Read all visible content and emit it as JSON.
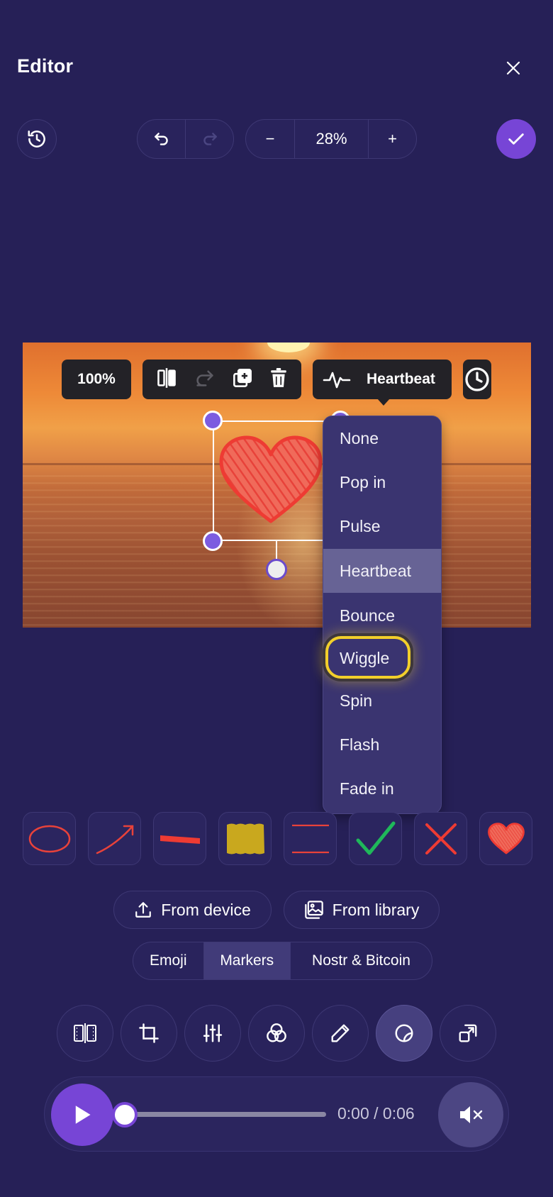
{
  "header": {
    "title": "Editor"
  },
  "toolbar": {
    "zoom_minus": "−",
    "zoom_value": "28%",
    "zoom_plus": "+"
  },
  "canvas_bar": {
    "opacity": "100%",
    "animation_label": "Heartbeat"
  },
  "animation_menu": {
    "items": [
      "None",
      "Pop in",
      "Pulse",
      "Heartbeat",
      "Bounce",
      "Wiggle",
      "Spin",
      "Flash",
      "Fade in"
    ],
    "selected": "Heartbeat",
    "highlighted": "Wiggle"
  },
  "sources": {
    "device_label": "From device",
    "library_label": "From library"
  },
  "categories": {
    "tabs": [
      "Emoji",
      "Markers",
      "Nostr & Bitcoin"
    ],
    "active": "Markers"
  },
  "player": {
    "time": "0:00 / 0:06",
    "progress": 0.0
  },
  "colors": {
    "background": "#262057",
    "accent": "#7745d6",
    "highlight": "#f2cf2b",
    "marker_red": "#e8423a",
    "marker_yellow": "#c9a81e",
    "marker_green": "#1fb85a"
  }
}
